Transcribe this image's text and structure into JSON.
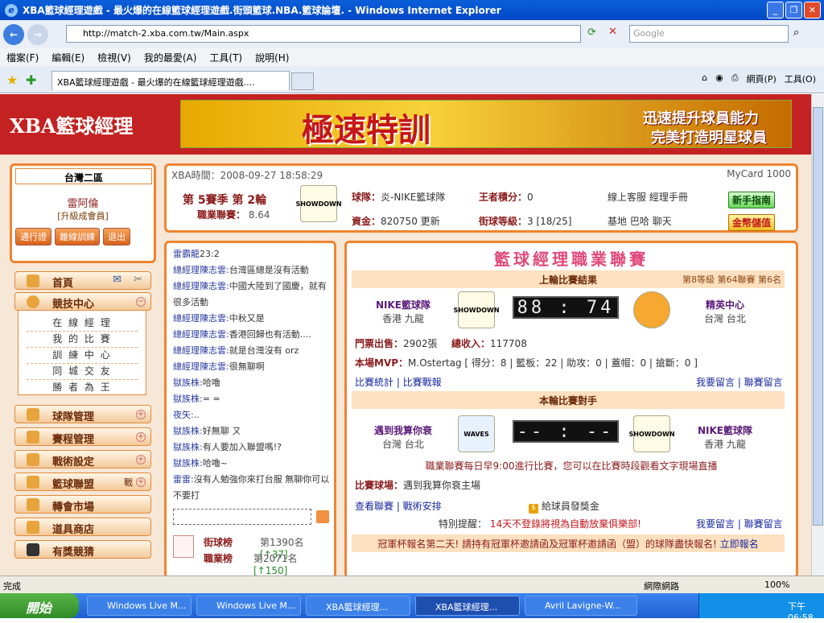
{
  "window": {
    "title": "XBA籃球經理遊戲 - 最火爆的在線籃球經理遊戲.街頭籃球.NBA.籃球論壇. - Windows Internet Explorer"
  },
  "address": {
    "url": "http://match-2.xba.com.tw/Main.aspx",
    "search_placeholder": "Google"
  },
  "menu": [
    "檔案(F)",
    "編輯(E)",
    "檢視(V)",
    "我的最愛(A)",
    "工具(T)",
    "說明(H)"
  ],
  "tab": {
    "label": "XBA籃球經理遊戲 - 最火爆的在線籃球經理遊戲...."
  },
  "toolbar": {
    "page": "網頁(P)",
    "tools": "工具(O)"
  },
  "site": {
    "logo": "XBA籃球經理",
    "banner_title": "極速特訓",
    "banner_line1": "迅速提升球員能力",
    "banner_line2": "完美打造明星球員"
  },
  "profile": {
    "region": "台灣二區",
    "name": "雷阿倫",
    "rank": "[升級成會員]",
    "buttons": [
      "通行證",
      "離線訓練",
      "退出"
    ]
  },
  "nav": {
    "home": "首頁",
    "competition": "競技中心",
    "subs": [
      "在 線 經 理",
      "我 的 比 賽",
      "訓 練 中 心",
      "同 城 交 友",
      "勝 者 為 王"
    ],
    "items": [
      "球隊管理",
      "賽程管理",
      "戰術設定",
      "籃球聯盟",
      "轉會市場",
      "道具商店",
      "有獎競猜"
    ],
    "league_tag": "戰"
  },
  "info": {
    "time": "XBA時間：2008-09-27 18:58:29",
    "mycard": "MyCard 1000",
    "season": "第 5賽季 第 2輪",
    "league_points_label": "職業聯賽：",
    "league_points": "8.64",
    "team_label": "球隊：",
    "team": "炎-NIKE籃球隊",
    "king_label": "王者積分：",
    "king": "0",
    "service": "線上客服 經理手冊",
    "funds_label": "資金：",
    "funds": "820750",
    "update": "更新",
    "level_label": "街球等級：",
    "level": "3 [18/25]",
    "bases": "基地 巴哈 聊天",
    "newbie_btn": "新手指南",
    "gold_btn": "金幣儲值"
  },
  "chat": {
    "lines": [
      {
        "name": "雷霸龍",
        "text": "23:2"
      },
      {
        "name": "總經理陳志雲:",
        "text": "台灣區總是沒有活動"
      },
      {
        "name": "總經理陳志雲:",
        "text": "中國大陸到了國慶，就有很多活動"
      },
      {
        "name": "總經理陳志雲:",
        "text": "中秋又是"
      },
      {
        "name": "總經理陳志雲:",
        "text": "香港回歸也有活動...."
      },
      {
        "name": "總經理陳志雲:",
        "text": "就是台灣沒有 orz"
      },
      {
        "name": "總經理陳志雲:",
        "text": "很無聊啊"
      },
      {
        "name": "獄族株:",
        "text": "哈嚕"
      },
      {
        "name": "獄族株:",
        "text": "= ="
      },
      {
        "name": "夜矢:",
        "text": ".."
      },
      {
        "name": "獄族株:",
        "text": "好無聊 ㄡ"
      },
      {
        "name": "獄族株:",
        "text": "有人要加入聯盟嗎!?"
      },
      {
        "name": "獄族株:",
        "text": "哈嚕~"
      },
      {
        "name": "雷雷:",
        "text": "沒有人勉強你來打台服 無聊你可以不要打"
      }
    ],
    "rank1_label": "街球榜",
    "rank1_value": "第1390名",
    "rank1_delta": "[↑37]",
    "rank2_label": "職業榜",
    "rank2_value": "第2071名",
    "rank2_delta": "[↑150]"
  },
  "game": {
    "title": "籃球經理職業聯賽",
    "last_title": "上輪比賽結果",
    "last_meta": "第8等級 第64聯賽 第6名",
    "home_team": "NIKE籃球隊",
    "home_city": "香港 九龍",
    "score": "88 : 74",
    "away_team": "精英中心",
    "away_city": "台灣 台北",
    "tickets_label": "門票出售：",
    "tickets": "2902張",
    "income_label": "總收入：",
    "income": "117708",
    "mvp_label": "本場MVP：",
    "mvp": "M.Ostertag [ 得分：8 | 籃板：22 | 助攻：0 | 蓋帽：0 | 搶斷：0 ]",
    "links1": "比賽統計 | 比賽戰報",
    "links_msg": "我要留言 | 聯賽留言",
    "next_title": "本輪比賽對手",
    "next_home": "遇到我算你衰",
    "next_home_city": "台灣 台北",
    "next_score": "-- : --",
    "next_away": "NIKE籃球隊",
    "next_away_city": "香港 九龍",
    "schedule_note": "職業聯賽每日早9:00進行比賽，您可以在比賽時段觀看文字現場直播",
    "venue_label": "比賽球場：",
    "venue": "遇到我算你衰主場",
    "links2": "查看聯賽 | 戰術安排",
    "bonus": "給球員發獎金",
    "reminder_label": "特別提醒：",
    "reminder": "14天不登錄將視為自動放棄俱樂部!",
    "notice": "冠軍杯報名第二天! 請持有冠軍杯邀請函及冠軍杯邀請函（盟）的球隊盡快報名!",
    "notice_link": "立即報名"
  },
  "statusbar": {
    "status": "完成",
    "zone": "網際網路",
    "zoom": "100%"
  },
  "taskbar": {
    "start": "開始",
    "items": [
      "Windows Live M...",
      "Windows Live M...",
      "XBA籃球經理...",
      "XBA籃球經理...",
      "Avril Lavigne-W..."
    ],
    "clock": "下午 06:58"
  }
}
